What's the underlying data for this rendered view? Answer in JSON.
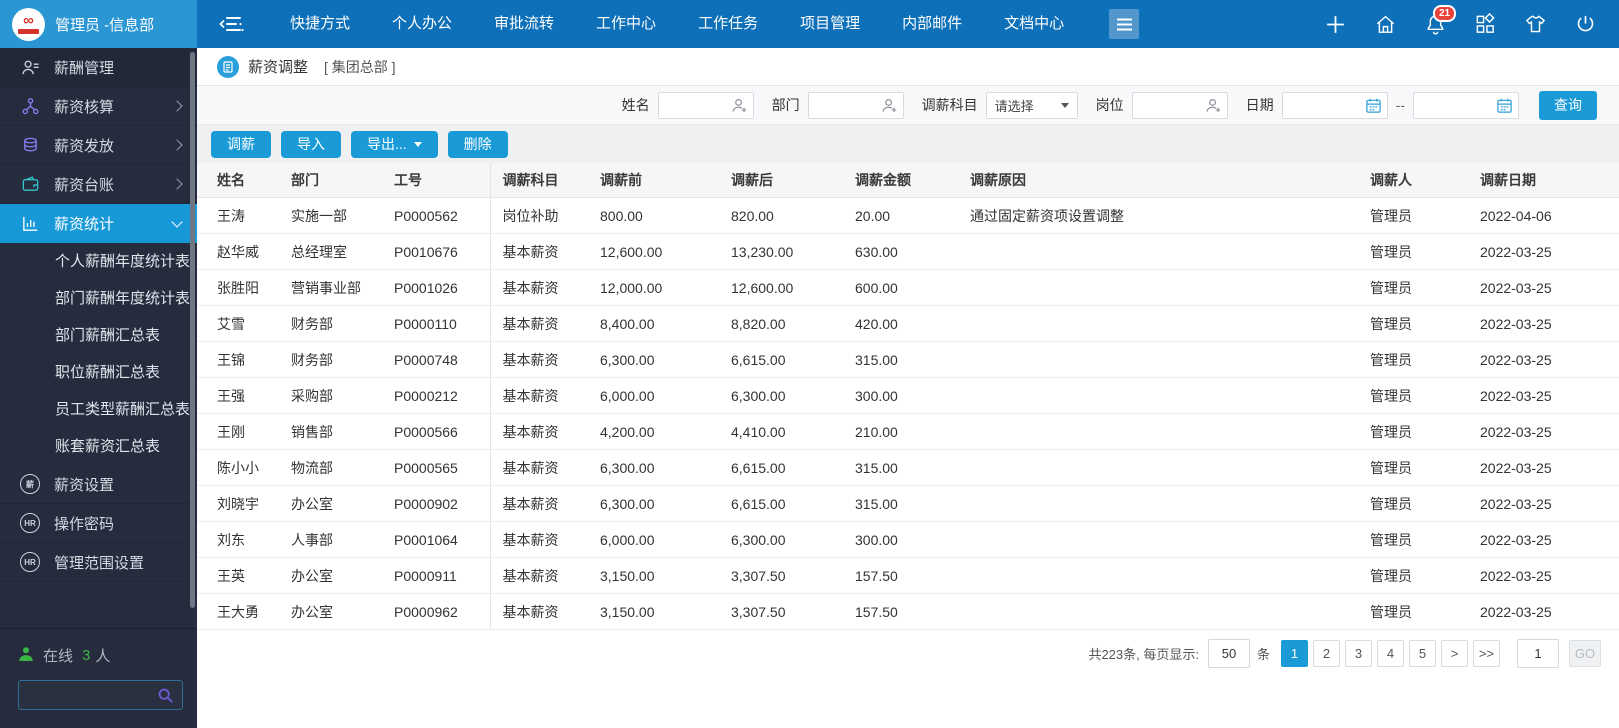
{
  "colors": {
    "accent": "#1a9bd7",
    "topbar": "#0e70b8",
    "topbar_left": "#2b96d4",
    "sidebar": "#262c3d",
    "sidebar_active": "#1799d8",
    "badge_red": "#e8423b",
    "online_green": "#3cb547"
  },
  "topbar": {
    "user": "管理员 -信息部",
    "nav": [
      "快捷方式",
      "个人办公",
      "审批流转",
      "工作中心",
      "工作任务",
      "项目管理",
      "内部邮件",
      "文档中心"
    ],
    "icons": [
      "plus",
      "home",
      "bell",
      "apps",
      "theme",
      "logout"
    ],
    "badge": "21"
  },
  "sidebar": {
    "items": [
      {
        "label": "薪酬管理",
        "icon": "roster",
        "section": true
      },
      {
        "label": "薪资核算",
        "icon": "network",
        "arrow": "right"
      },
      {
        "label": "薪资发放",
        "icon": "coins",
        "arrow": "right"
      },
      {
        "label": "薪资台账",
        "icon": "wallet",
        "arrow": "right"
      },
      {
        "label": "薪资统计",
        "icon": "chart",
        "arrow": "down",
        "active": true
      },
      {
        "label": "个人薪酬年度统计表",
        "type": "sub"
      },
      {
        "label": "部门薪酬年度统计表",
        "type": "sub"
      },
      {
        "label": "部门薪酬汇总表",
        "type": "sub"
      },
      {
        "label": "职位薪酬汇总表",
        "type": "sub"
      },
      {
        "label": "员工类型薪酬汇总表",
        "type": "sub"
      },
      {
        "label": "账套薪资汇总表",
        "type": "sub"
      },
      {
        "label": "薪资设置",
        "icon": "circle-text",
        "icon_text": "薪"
      },
      {
        "label": "操作密码",
        "icon": "circle-text",
        "icon_text": "HR"
      },
      {
        "label": "管理范围设置",
        "icon": "circle-text",
        "icon_text": "HR"
      }
    ],
    "online": {
      "label": "在线",
      "count": "3",
      "suffix": "人"
    }
  },
  "breadcrumb": {
    "title": "薪资调整",
    "scope": "[ 集团总部 ]"
  },
  "filters": {
    "name_label": "姓名",
    "dept_label": "部门",
    "subject_label": "调薪科目",
    "subject_value": "请选择",
    "post_label": "岗位",
    "date_label": "日期",
    "range_separator": "--",
    "query_label": "查询"
  },
  "toolbar": {
    "buttons": [
      "调薪",
      "导入",
      "导出...",
      "删除"
    ]
  },
  "table": {
    "columns": [
      "姓名",
      "部门",
      "工号",
      "调薪科目",
      "调薪前",
      "调薪后",
      "调薪金额",
      "调薪原因",
      "调薪人",
      "调薪日期"
    ],
    "rows": [
      [
        "王涛",
        "实施一部",
        "P0000562",
        "岗位补助",
        "800.00",
        "820.00",
        "20.00",
        "通过固定薪资项设置调整",
        "管理员",
        "2022-04-06"
      ],
      [
        "赵华威",
        "总经理室",
        "P0010676",
        "基本薪资",
        "12,600.00",
        "13,230.00",
        "630.00",
        "",
        "管理员",
        "2022-03-25"
      ],
      [
        "张胜阳",
        "营销事业部",
        "P0001026",
        "基本薪资",
        "12,000.00",
        "12,600.00",
        "600.00",
        "",
        "管理员",
        "2022-03-25"
      ],
      [
        "艾雪",
        "财务部",
        "P0000110",
        "基本薪资",
        "8,400.00",
        "8,820.00",
        "420.00",
        "",
        "管理员",
        "2022-03-25"
      ],
      [
        "王锦",
        "财务部",
        "P0000748",
        "基本薪资",
        "6,300.00",
        "6,615.00",
        "315.00",
        "",
        "管理员",
        "2022-03-25"
      ],
      [
        "王强",
        "采购部",
        "P0000212",
        "基本薪资",
        "6,000.00",
        "6,300.00",
        "300.00",
        "",
        "管理员",
        "2022-03-25"
      ],
      [
        "王刚",
        "销售部",
        "P0000566",
        "基本薪资",
        "4,200.00",
        "4,410.00",
        "210.00",
        "",
        "管理员",
        "2022-03-25"
      ],
      [
        "陈小小",
        "物流部",
        "P0000565",
        "基本薪资",
        "6,300.00",
        "6,615.00",
        "315.00",
        "",
        "管理员",
        "2022-03-25"
      ],
      [
        "刘晓宇",
        "办公室",
        "P0000902",
        "基本薪资",
        "6,300.00",
        "6,615.00",
        "315.00",
        "",
        "管理员",
        "2022-03-25"
      ],
      [
        "刘东",
        "人事部",
        "P0001064",
        "基本薪资",
        "6,000.00",
        "6,300.00",
        "300.00",
        "",
        "管理员",
        "2022-03-25"
      ],
      [
        "王英",
        "办公室",
        "P0000911",
        "基本薪资",
        "3,150.00",
        "3,307.50",
        "157.50",
        "",
        "管理员",
        "2022-03-25"
      ],
      [
        "王大勇",
        "办公室",
        "P0000962",
        "基本薪资",
        "3,150.00",
        "3,307.50",
        "157.50",
        "",
        "管理员",
        "2022-03-25"
      ]
    ]
  },
  "pagination": {
    "total_text": "共223条, 每页显示:",
    "page_size": "50",
    "unit": "条",
    "pages": [
      "1",
      "2",
      "3",
      "4",
      "5",
      ">",
      ">>"
    ],
    "active_index": 0,
    "jump_value": "1",
    "go_label": "GO"
  }
}
